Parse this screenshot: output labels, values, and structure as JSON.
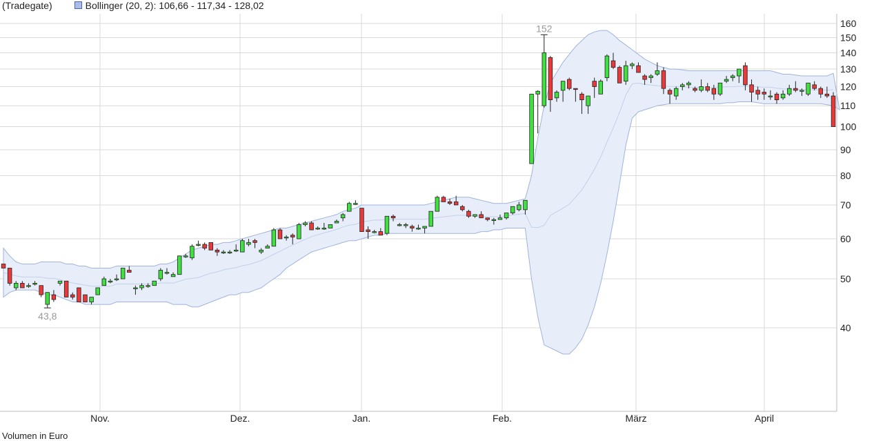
{
  "legend": {
    "source": "(Tradegate)",
    "indicator": "Bollinger (20, 2): 106,66 - 117,34 - 128,02",
    "band_color": "#a9bde8"
  },
  "volume_label": "Volumen in Euro",
  "chart_data": {
    "type": "candlestick",
    "scale": "log",
    "ylim": [
      30,
      165
    ],
    "yticks": [
      40,
      50,
      60,
      70,
      80,
      90,
      100,
      110,
      120,
      130,
      140,
      150,
      160
    ],
    "month_labels": [
      "Nov.",
      "Dez.",
      "Jan.",
      "Feb.",
      "März",
      "April"
    ],
    "grid": true,
    "annotations": [
      {
        "text": "152",
        "value": 152,
        "kind": "high"
      },
      {
        "text": "43,8",
        "value": 43.8,
        "kind": "low"
      }
    ],
    "colors": {
      "up": "#3fe03f",
      "down": "#e83a3a",
      "band": "#e8eef9",
      "band_line": "#9fb3dd"
    },
    "candles": [
      [
        53.5,
        53.5,
        52.5,
        52.5
      ],
      [
        52.5,
        52.5,
        48.5,
        49
      ],
      [
        48,
        49.5,
        47.5,
        49
      ],
      [
        49,
        49.5,
        48,
        48
      ],
      [
        48.5,
        49,
        48,
        48.5
      ],
      [
        49,
        49.5,
        48.5,
        49
      ],
      [
        48.5,
        48.5,
        46,
        46.5
      ],
      [
        44.5,
        47,
        43.8,
        47
      ],
      [
        46.5,
        47.5,
        45,
        45.5
      ],
      [
        49,
        49.5,
        48.5,
        49.5
      ],
      [
        49.5,
        49.5,
        46,
        46
      ],
      [
        46.5,
        47,
        45.5,
        46
      ],
      [
        48,
        48,
        45,
        45
      ],
      [
        46.5,
        46.5,
        45,
        45
      ],
      [
        45,
        46,
        44.5,
        46
      ],
      [
        46.5,
        48,
        46.5,
        48
      ],
      [
        48.5,
        50.5,
        48.5,
        50
      ],
      [
        49.5,
        50,
        49,
        49.5
      ],
      [
        50,
        51,
        49.5,
        50
      ],
      [
        50,
        52.5,
        50,
        52.5
      ],
      [
        52,
        53,
        51.5,
        51.5
      ],
      [
        48,
        48.5,
        46.5,
        48
      ],
      [
        48,
        49,
        47.5,
        48.5
      ],
      [
        48.5,
        49,
        48,
        48.5
      ],
      [
        48.5,
        49.5,
        48.5,
        49.5
      ],
      [
        50,
        52.5,
        49.5,
        52
      ],
      [
        51.5,
        52.5,
        51,
        51.5
      ],
      [
        50.5,
        51.5,
        50.5,
        51
      ],
      [
        51,
        55.5,
        51,
        55.5
      ],
      [
        55.5,
        56,
        55,
        55.5
      ],
      [
        55,
        58.5,
        54.5,
        58
      ],
      [
        58.5,
        59.5,
        58,
        58.5
      ],
      [
        58.5,
        59,
        57,
        57.5
      ],
      [
        59,
        59,
        57,
        57
      ],
      [
        57,
        57.5,
        55.5,
        56.5
      ],
      [
        56.5,
        57,
        56,
        56.5
      ],
      [
        56.5,
        57,
        56,
        56.5
      ],
      [
        57,
        58.5,
        56.5,
        57
      ],
      [
        56.5,
        60,
        56.5,
        59.5
      ],
      [
        58.5,
        60,
        58,
        59
      ],
      [
        59.5,
        60,
        57.5,
        59
      ],
      [
        56.5,
        57.5,
        56,
        57
      ],
      [
        57.5,
        58.5,
        57.5,
        58
      ],
      [
        58,
        63,
        58,
        62.5
      ],
      [
        62.5,
        63,
        60,
        60
      ],
      [
        60.5,
        61,
        59.5,
        60.5
      ],
      [
        61,
        61.5,
        58.5,
        60.5
      ],
      [
        60,
        64.5,
        60,
        64
      ],
      [
        64,
        65,
        63.5,
        64.5
      ],
      [
        64.5,
        65,
        62.5,
        62.5
      ],
      [
        63,
        63.5,
        62.5,
        63
      ],
      [
        63,
        64.5,
        62.5,
        63
      ],
      [
        63,
        64,
        63,
        64
      ],
      [
        64.5,
        65.5,
        64.5,
        65
      ],
      [
        66,
        67.5,
        65,
        67
      ],
      [
        68,
        71,
        68,
        70.5
      ],
      [
        70.5,
        71.5,
        70,
        70.5
      ],
      [
        69,
        69,
        62,
        62
      ],
      [
        62.5,
        63.5,
        60,
        62
      ],
      [
        62,
        62.5,
        61.5,
        62
      ],
      [
        62,
        63,
        61,
        61
      ],
      [
        61.5,
        66.5,
        61,
        66.5
      ],
      [
        66.5,
        67,
        65,
        66
      ],
      [
        64,
        64.5,
        63.5,
        64
      ],
      [
        64,
        64.5,
        63,
        64
      ],
      [
        63.5,
        64,
        62,
        63
      ],
      [
        63,
        64,
        62.5,
        63
      ],
      [
        63,
        63.5,
        61.5,
        63.5
      ],
      [
        63.5,
        68,
        63.5,
        68
      ],
      [
        68,
        73,
        68,
        72.5
      ],
      [
        72.5,
        73,
        71,
        71
      ],
      [
        71,
        72,
        70,
        70.5
      ],
      [
        71,
        73,
        70.5,
        70
      ],
      [
        69.5,
        70,
        68,
        68.5
      ],
      [
        68,
        68.5,
        66,
        66.5
      ],
      [
        66.5,
        67,
        66,
        67
      ],
      [
        67,
        68,
        66,
        66
      ],
      [
        66,
        66,
        65,
        65.5
      ],
      [
        65.5,
        66,
        64,
        65.5
      ],
      [
        65.5,
        67,
        65.5,
        66
      ],
      [
        66,
        67.5,
        65.5,
        67.5
      ],
      [
        67.5,
        69.5,
        67,
        69.5
      ],
      [
        68.5,
        71,
        68,
        70
      ],
      [
        68.5,
        71.5,
        67,
        71.5
      ],
      [
        84.5,
        116,
        84.5,
        116
      ],
      [
        116,
        118,
        97,
        117.5
      ],
      [
        110,
        152,
        109,
        140
      ],
      [
        137,
        138,
        107,
        113
      ],
      [
        114,
        118,
        112,
        117
      ],
      [
        118,
        122,
        112,
        123
      ],
      [
        124,
        125,
        118,
        119
      ],
      [
        119,
        119,
        112,
        118.5
      ],
      [
        116,
        117,
        106,
        113
      ],
      [
        110,
        114,
        106,
        115
      ],
      [
        123,
        125,
        114,
        120
      ],
      [
        116,
        124,
        117,
        123
      ],
      [
        125,
        139,
        123,
        138
      ],
      [
        135,
        140,
        130,
        131
      ],
      [
        131,
        132,
        122,
        122
      ],
      [
        123,
        135,
        121,
        132
      ],
      [
        132,
        134,
        130,
        133
      ],
      [
        132,
        134,
        128,
        128
      ],
      [
        126,
        127,
        121,
        124
      ],
      [
        125,
        127,
        122,
        126
      ],
      [
        127,
        134,
        126,
        129
      ],
      [
        129,
        131,
        116,
        119
      ],
      [
        118,
        119,
        111,
        116
      ],
      [
        115,
        120,
        113,
        119
      ],
      [
        120,
        122,
        118,
        121
      ],
      [
        121,
        123,
        119,
        122
      ],
      [
        119,
        120,
        117,
        118
      ],
      [
        118,
        124,
        117,
        120
      ],
      [
        120,
        122,
        117,
        118
      ],
      [
        119,
        121,
        113,
        116
      ],
      [
        116,
        122,
        115,
        122
      ],
      [
        123,
        126,
        122,
        124
      ],
      [
        125,
        127,
        123,
        126
      ],
      [
        126,
        129,
        122,
        130
      ],
      [
        132,
        134,
        118,
        121
      ],
      [
        121,
        124,
        112,
        117
      ],
      [
        118,
        120,
        113,
        116
      ],
      [
        117,
        119,
        113,
        116
      ],
      [
        115,
        118,
        113,
        115
      ],
      [
        116,
        117,
        111,
        113
      ],
      [
        114,
        118,
        113,
        116
      ],
      [
        116,
        121,
        115,
        119
      ],
      [
        119,
        123,
        117,
        118
      ],
      [
        118,
        119,
        115,
        118
      ],
      [
        116,
        122,
        115,
        122
      ],
      [
        121,
        123,
        118,
        119
      ],
      [
        119,
        120,
        114,
        116
      ],
      [
        116,
        120,
        114,
        115
      ],
      [
        115,
        117,
        110,
        100
      ]
    ],
    "bollinger": {
      "upper": [
        57.5,
        55.5,
        54,
        53.5,
        53.5,
        53.5,
        54,
        54,
        54,
        54,
        53.5,
        53.5,
        53,
        53,
        52.5,
        52.5,
        52.5,
        52.5,
        53,
        53,
        53,
        53,
        53,
        53,
        53,
        53.5,
        53.5,
        54,
        55,
        56,
        57,
        57.5,
        58,
        58.5,
        58.5,
        59,
        59,
        59.5,
        60,
        60.5,
        61,
        61.5,
        62,
        62.5,
        63,
        63,
        63.5,
        64,
        64.5,
        65,
        65.5,
        66,
        66.5,
        67,
        68,
        68.5,
        69,
        70,
        70,
        70,
        70,
        70,
        70,
        70,
        70,
        70,
        70,
        70,
        70.5,
        71,
        71.5,
        72,
        72.5,
        72.5,
        72.5,
        72,
        71.5,
        71,
        70.5,
        70.5,
        70.5,
        71,
        71.5,
        72,
        80,
        95,
        110,
        122,
        128,
        134,
        139,
        144,
        148,
        152,
        154,
        155,
        155,
        152,
        148,
        145,
        142,
        139,
        136,
        134,
        132,
        131,
        130,
        130,
        129.5,
        129,
        129,
        129,
        129,
        129,
        129,
        129,
        129,
        129,
        129,
        129,
        129,
        129,
        129,
        128,
        127,
        127,
        126.5,
        126,
        126,
        126,
        126,
        126,
        127.5
      ],
      "lower": [
        46,
        47,
        47.5,
        47.5,
        47.5,
        47.5,
        47,
        46.5,
        46.5,
        46,
        45.5,
        45,
        45,
        44.5,
        44.5,
        44.5,
        44.5,
        44.5,
        45,
        45,
        45,
        45,
        45,
        45,
        45,
        45,
        45,
        44.5,
        44.5,
        44.5,
        44,
        44,
        44.5,
        45,
        45.5,
        46,
        46.5,
        46.5,
        47,
        47,
        47.5,
        48,
        49,
        50,
        51,
        52.5,
        53.5,
        54.5,
        55.5,
        56.5,
        57,
        57.5,
        58,
        58.5,
        59,
        59.5,
        59.5,
        60,
        60.5,
        61,
        61,
        61.5,
        61.5,
        61.5,
        61.5,
        61.5,
        61.5,
        61.5,
        61.5,
        61.5,
        61.5,
        61.5,
        61.5,
        61.5,
        61.5,
        61.5,
        62,
        62,
        62.5,
        62.5,
        63,
        63,
        63,
        63,
        50,
        42,
        37,
        36.5,
        36,
        35.5,
        35.5,
        36.5,
        38,
        40.5,
        44,
        49,
        56,
        65,
        77,
        92,
        104,
        107,
        108,
        109,
        110,
        110.5,
        111,
        111,
        111,
        111,
        111,
        111,
        111,
        111,
        111,
        111.5,
        111.5,
        112,
        112,
        112,
        111.5,
        111,
        111,
        111,
        111,
        111,
        111,
        111,
        111,
        111,
        111,
        110.5,
        110,
        108
      ]
    }
  }
}
